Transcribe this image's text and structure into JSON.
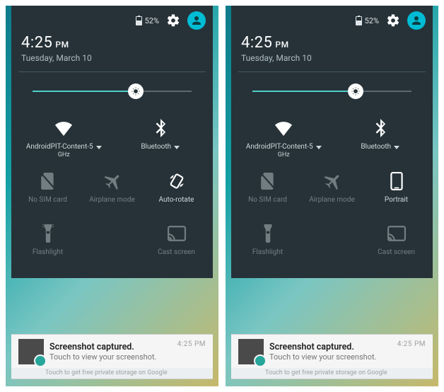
{
  "panels": [
    {
      "status": {
        "battery_percent": "52%"
      },
      "clock": {
        "time": "4:25",
        "ampm": "PM",
        "date": "Tuesday, March 10"
      },
      "brightness_percent": 65,
      "tiles_top": {
        "wifi": {
          "label": "AndroidPIT-Content-5",
          "sub": "GHz",
          "has_caret": true,
          "enabled": true
        },
        "bluetooth": {
          "label": "Bluetooth",
          "has_caret": true,
          "enabled": true
        }
      },
      "tiles_mid": {
        "sim": {
          "label": "No SIM card",
          "enabled": false
        },
        "airplane": {
          "label": "Airplane mode",
          "enabled": false
        },
        "rotation": {
          "label": "Auto-rotate",
          "mode": "auto",
          "enabled": true
        }
      },
      "tiles_bot": {
        "flashlight": {
          "label": "Flashlight",
          "enabled": false
        },
        "cast": {
          "label": "Cast screen",
          "enabled": false
        }
      },
      "notification": {
        "title": "Screenshot captured.",
        "desc": "Touch to view your screenshot.",
        "time": "4:25 PM",
        "under_text": "Touch to get free private storage on Google"
      }
    },
    {
      "status": {
        "battery_percent": "52%"
      },
      "clock": {
        "time": "4:25",
        "ampm": "PM",
        "date": "Tuesday, March 10"
      },
      "brightness_percent": 65,
      "tiles_top": {
        "wifi": {
          "label": "AndroidPIT-Content-5",
          "sub": "GHz",
          "has_caret": true,
          "enabled": true
        },
        "bluetooth": {
          "label": "Bluetooth",
          "has_caret": true,
          "enabled": true
        }
      },
      "tiles_mid": {
        "sim": {
          "label": "No SIM card",
          "enabled": false
        },
        "airplane": {
          "label": "Airplane mode",
          "enabled": false
        },
        "rotation": {
          "label": "Portrait",
          "mode": "portrait",
          "enabled": true
        }
      },
      "tiles_bot": {
        "flashlight": {
          "label": "Flashlight",
          "enabled": false
        },
        "cast": {
          "label": "Cast screen",
          "enabled": false
        }
      },
      "notification": {
        "title": "Screenshot captured.",
        "desc": "Touch to view your screenshot.",
        "time": "4:25 PM",
        "under_text": "Touch to get free private storage on Google"
      }
    }
  ]
}
